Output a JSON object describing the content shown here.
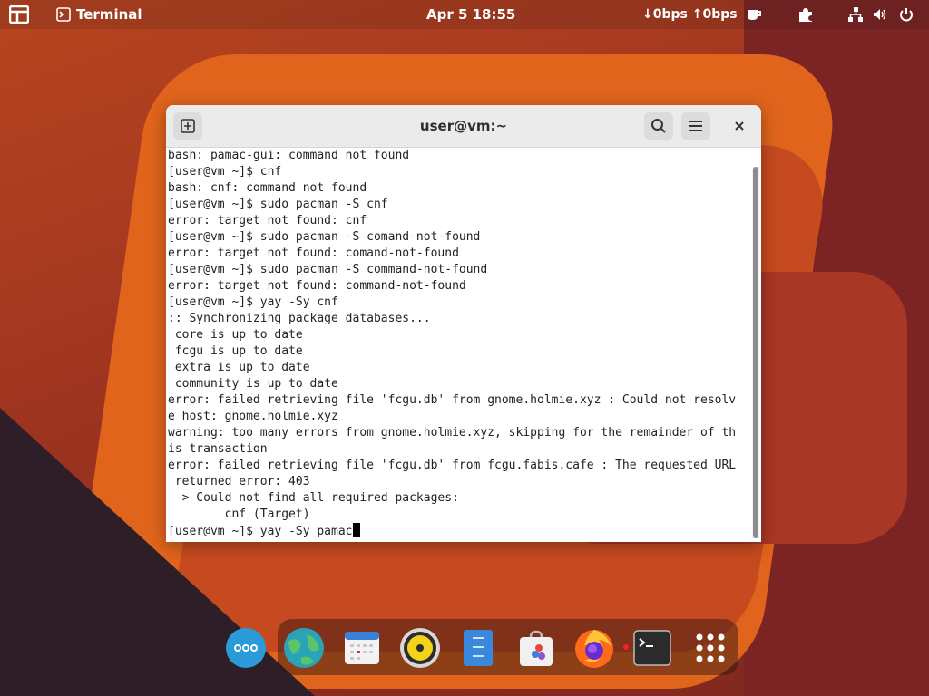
{
  "topbar": {
    "app_name": "Terminal",
    "clock": "Apr 5  18:55",
    "network_speed": "↓0bps ↑0bps",
    "icons": [
      "activities-grid-icon",
      "terminal-icon",
      "coffee-cup-icon",
      "puzzle-extension-icon",
      "network-icon",
      "volume-icon",
      "power-icon"
    ]
  },
  "window": {
    "title": "user@vm:~",
    "buttons": {
      "new_tab": "new-tab-icon",
      "search": "search-icon",
      "menu": "hamburger-menu-icon",
      "close": "close-icon"
    }
  },
  "terminal": {
    "lines": [
      "bash: pamac-gui: command not found",
      "[user@vm ~]$ cnf",
      "bash: cnf: command not found",
      "[user@vm ~]$ sudo pacman -S cnf",
      "error: target not found: cnf",
      "[user@vm ~]$ sudo pacman -S comand-not-found",
      "error: target not found: comand-not-found",
      "[user@vm ~]$ sudo pacman -S command-not-found",
      "error: target not found: command-not-found",
      "[user@vm ~]$ yay -Sy cnf",
      ":: Synchronizing package databases...",
      " core is up to date",
      " fcgu is up to date",
      " extra is up to date",
      " community is up to date",
      "error: failed retrieving file 'fcgu.db' from gnome.holmie.xyz : Could not resolv",
      "e host: gnome.holmie.xyz",
      "warning: too many errors from gnome.holmie.xyz, skipping for the remainder of th",
      "is transaction",
      "error: failed retrieving file 'fcgu.db' from fcgu.fabis.cafe : The requested URL",
      " returned error: 403",
      " -> Could not find all required packages:",
      "        cnf (Target)"
    ],
    "prompt_line": "[user@vm ~]$ yay -Sy pamac"
  },
  "dock": {
    "apps": [
      "app-grid-icon",
      "browser-globe-icon",
      "calendar-icon",
      "music-player-icon",
      "files-icon",
      "software-store-icon",
      "firefox-icon",
      "terminal-icon",
      "show-apps-icon"
    ]
  }
}
